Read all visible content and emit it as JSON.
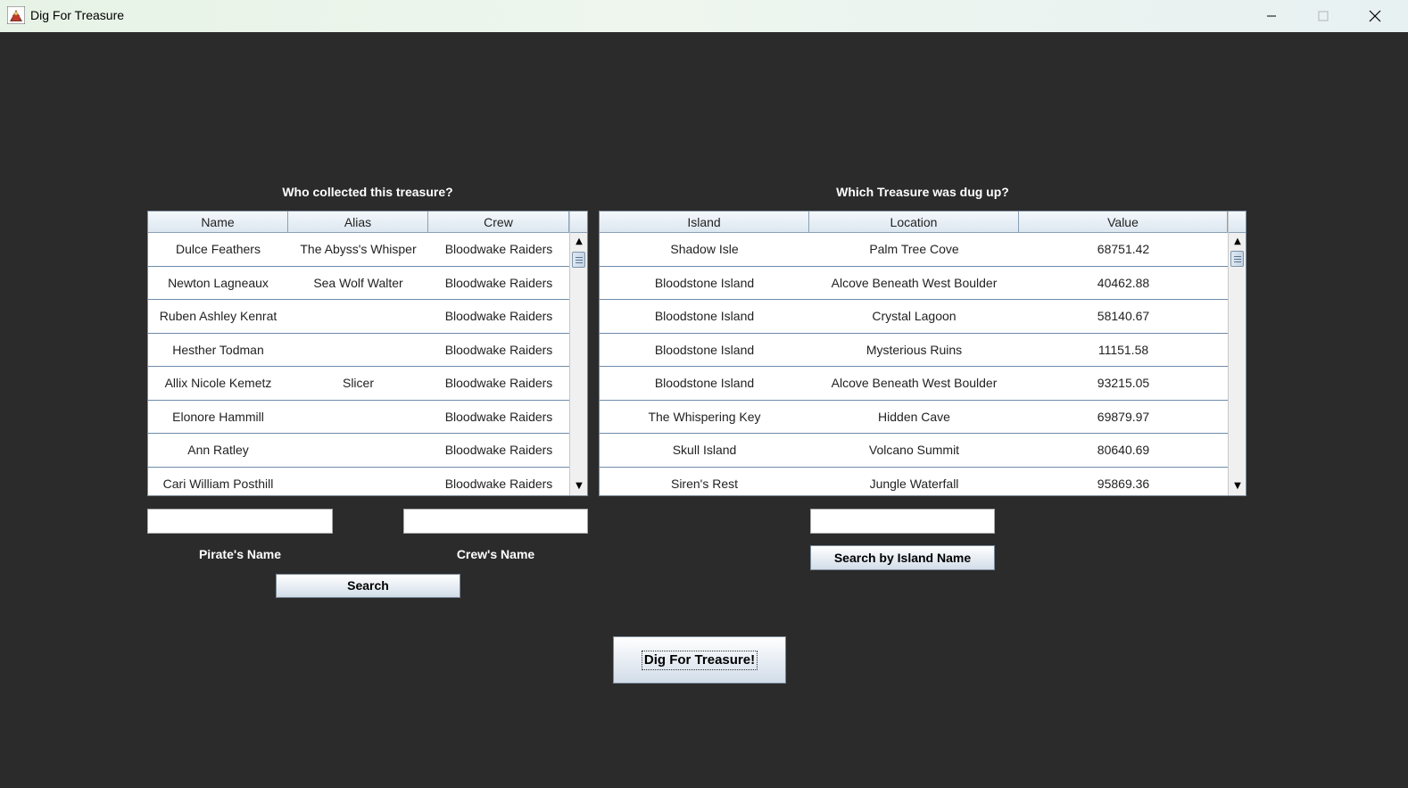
{
  "window": {
    "title": "Dig For Treasure"
  },
  "pirates_panel": {
    "title": "Who collected this treasure?",
    "columns": [
      "Name",
      "Alias",
      "Crew"
    ],
    "rows": [
      [
        "Dulce  Feathers",
        "The Abyss's Whisper",
        "Bloodwake Raiders"
      ],
      [
        "Newton  Lagneaux",
        "Sea Wolf Walter",
        "Bloodwake Raiders"
      ],
      [
        "Ruben Ashley Kenrat",
        "",
        "Bloodwake Raiders"
      ],
      [
        "Hesther  Todman",
        "",
        "Bloodwake Raiders"
      ],
      [
        "Allix Nicole Kemetz",
        "Slicer",
        "Bloodwake Raiders"
      ],
      [
        "Elonore  Hammill",
        "",
        "Bloodwake Raiders"
      ],
      [
        "Ann  Ratley",
        "",
        "Bloodwake Raiders"
      ],
      [
        "Cari William Posthill",
        "",
        "Bloodwake Raiders"
      ]
    ]
  },
  "treasure_panel": {
    "title": "Which Treasure was dug up?",
    "columns": [
      "Island",
      "Location",
      "Value"
    ],
    "rows": [
      [
        "Shadow Isle",
        "Palm Tree Cove",
        "68751.42"
      ],
      [
        "Bloodstone Island",
        "Alcove Beneath West Boulder",
        "40462.88"
      ],
      [
        "Bloodstone Island",
        "Crystal Lagoon",
        "58140.67"
      ],
      [
        "Bloodstone Island",
        "Mysterious Ruins",
        "11151.58"
      ],
      [
        "Bloodstone Island",
        "Alcove Beneath West Boulder",
        "93215.05"
      ],
      [
        "The Whispering Key",
        "Hidden Cave",
        "69879.97"
      ],
      [
        "Skull Island",
        "Volcano Summit",
        "80640.69"
      ],
      [
        "Siren's Rest",
        "Jungle Waterfall",
        "95869.36"
      ]
    ]
  },
  "search": {
    "pirate_name_label": "Pirate's Name",
    "pirate_name_value": "",
    "crew_name_label": "Crew's Name",
    "crew_name_value": "",
    "search_button": "Search",
    "island_name_value": "",
    "island_search_button": "Search by Island Name"
  },
  "dig_button": "Dig For Treasure!",
  "icons": {
    "app": "treasure-app-icon",
    "minimize": "minimize-icon",
    "maximize": "maximize-icon",
    "close": "close-icon",
    "scroll_up": "arrow-up-icon",
    "scroll_down": "arrow-down-icon"
  },
  "colors": {
    "background": "#2b2b2b",
    "table_grid": "#6e8bab"
  }
}
